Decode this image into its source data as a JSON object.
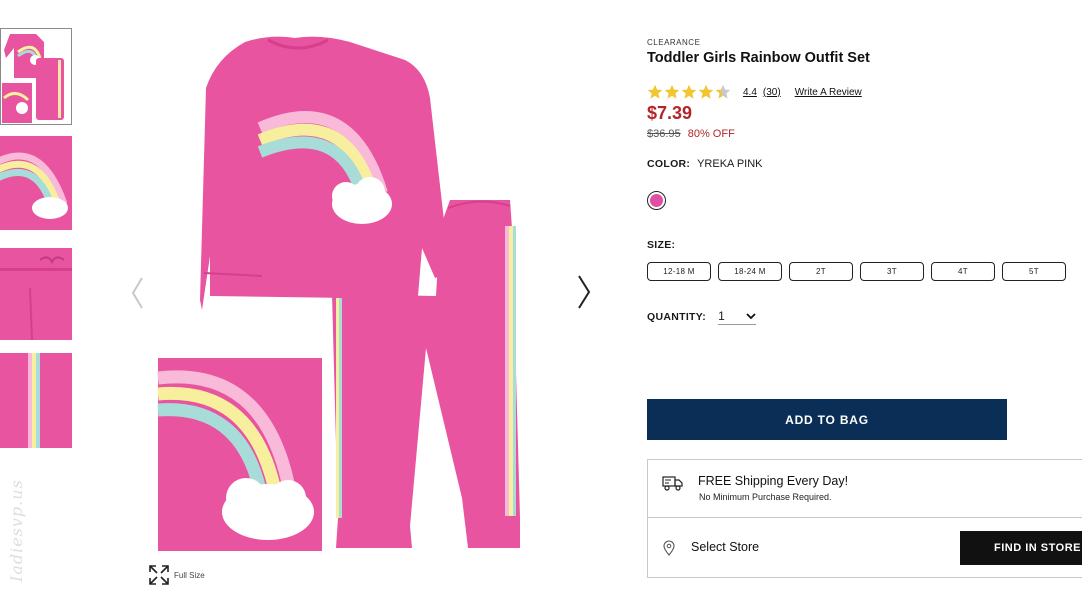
{
  "product": {
    "badge": "CLEARANCE",
    "title": "Toddler Girls Rainbow Outfit Set",
    "rating_value": "4.4",
    "rating_count": "(30)",
    "rating_stars": 4.4,
    "write_review": "Write A Review",
    "sale_price": "$7.39",
    "original_price": "$36.95",
    "discount": "80% OFF"
  },
  "color": {
    "label": "COLOR:",
    "value": "YREKA PINK",
    "swatch": "#e04fa3"
  },
  "size": {
    "label": "SIZE:",
    "options": [
      "12-18 M",
      "18-24 M",
      "2T",
      "3T",
      "4T",
      "5T"
    ]
  },
  "quantity": {
    "label": "QUANTITY:",
    "value": "1"
  },
  "buttons": {
    "add_to_bag": "ADD TO BAG",
    "find_in_store": "FIND IN STORE"
  },
  "shipping": {
    "title": "FREE Shipping Every Day!",
    "subtitle": "No Minimum Purchase Required."
  },
  "store": {
    "select": "Select Store"
  },
  "gallery": {
    "full_size": "Full Size",
    "watermark": "Iadiesvp.us"
  },
  "colors": {
    "pink": "#e8549f",
    "navy": "#0b2e57",
    "sale_red": "#b2262a"
  }
}
